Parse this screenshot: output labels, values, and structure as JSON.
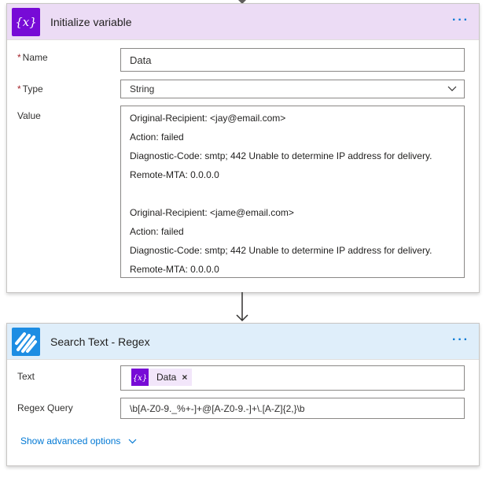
{
  "variable_card": {
    "title": "Initialize variable",
    "icon": "variable-icon",
    "more_label": "···",
    "name": {
      "label": "Name",
      "required_mark": "*",
      "value": "Data"
    },
    "type": {
      "label": "Type",
      "required_mark": "*",
      "value": "String"
    },
    "value": {
      "label": "Value",
      "lines": [
        "Original-Recipient: <jay@email.com>",
        "Action: failed",
        "Diagnostic-Code: smtp; 442 Unable to determine IP address for delivery.",
        "Remote-MTA: 0.0.0.0",
        "",
        "Original-Recipient: <jame@email.com>",
        "Action: failed",
        "Diagnostic-Code: smtp; 442 Unable to determine IP address for delivery.",
        "Remote-MTA: 0.0.0.0"
      ]
    }
  },
  "regex_card": {
    "title": "Search Text - Regex",
    "icon": "regex-icon",
    "more_label": "···",
    "text": {
      "label": "Text",
      "token_label": "Data",
      "token_remove": "×"
    },
    "query": {
      "label": "Regex Query",
      "value": "\\b[A-Z0-9._%+-]+@[A-Z0-9.-]+\\.[A-Z]{2,}\\b"
    },
    "advanced_label": "Show advanced options"
  },
  "colors": {
    "variable_accent": "#770bd6",
    "variable_header": "#ecdcf5",
    "regex_accent": "#1d8de3",
    "regex_header": "#dfeefa",
    "link": "#0078d4"
  }
}
